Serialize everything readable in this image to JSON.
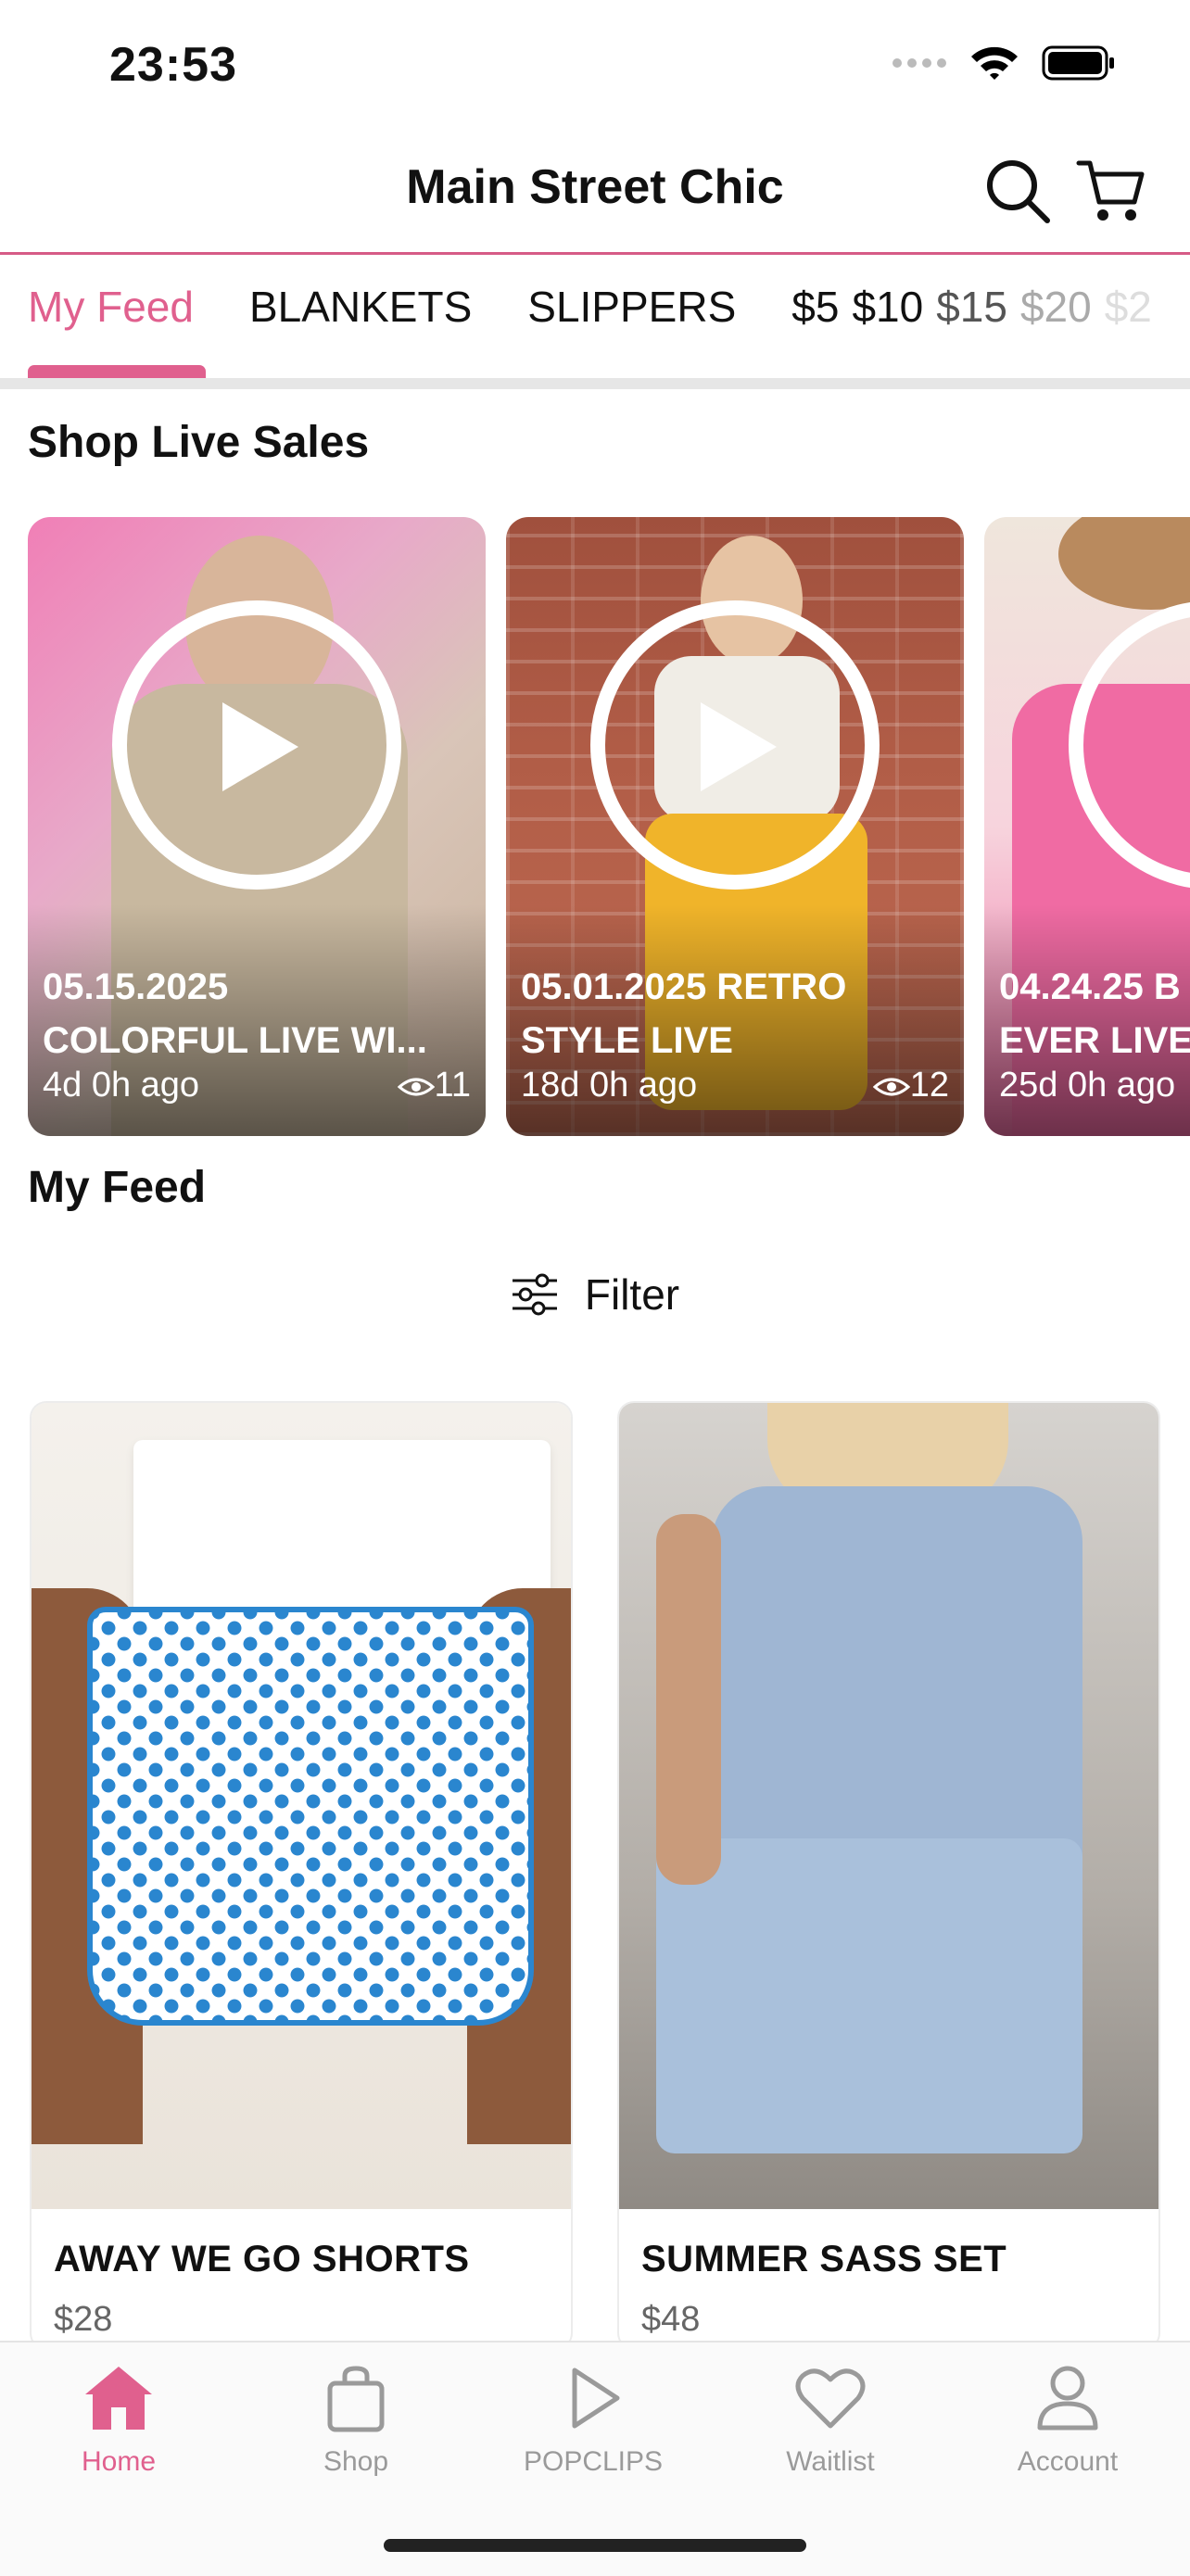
{
  "status_bar": {
    "time": "23:53"
  },
  "header": {
    "title": "Main Street Chic"
  },
  "tabs": {
    "items": [
      "My Feed",
      "BLANKETS",
      "SLIPPERS"
    ],
    "prices": [
      "$5",
      "$10",
      "$15",
      "$20",
      "$2"
    ]
  },
  "live_section": {
    "title": "Shop Live Sales",
    "cards": [
      {
        "line1": "05.15.2025",
        "line2": "COLORFUL LIVE WI...",
        "ago": "4d 0h ago",
        "views": "11"
      },
      {
        "line1": "05.01.2025 RETRO",
        "line2": "STYLE LIVE",
        "ago": "18d 0h ago",
        "views": "12"
      },
      {
        "line1": "04.24.25 B",
        "line2": "EVER LIVE",
        "ago": "25d 0h ago",
        "views": ""
      }
    ]
  },
  "feed": {
    "title": "My Feed",
    "filter_label": "Filter",
    "products": [
      {
        "name": "AWAY WE GO SHORTS",
        "price": "$28"
      },
      {
        "name": "SUMMER SASS SET",
        "price": "$48"
      }
    ]
  },
  "bottom_nav": {
    "items": [
      "Home",
      "Shop",
      "POPCLIPS",
      "Waitlist",
      "Account"
    ],
    "active": "Home"
  },
  "colors": {
    "accent": "#e0608e",
    "header_line": "#d65b86",
    "inactive_nav": "#9a9a9a"
  },
  "icons": [
    "search-icon",
    "cart-icon",
    "play-icon",
    "eye-icon",
    "filter-icon",
    "home-icon",
    "bag-icon",
    "popclips-icon",
    "heart-icon",
    "account-icon"
  ]
}
